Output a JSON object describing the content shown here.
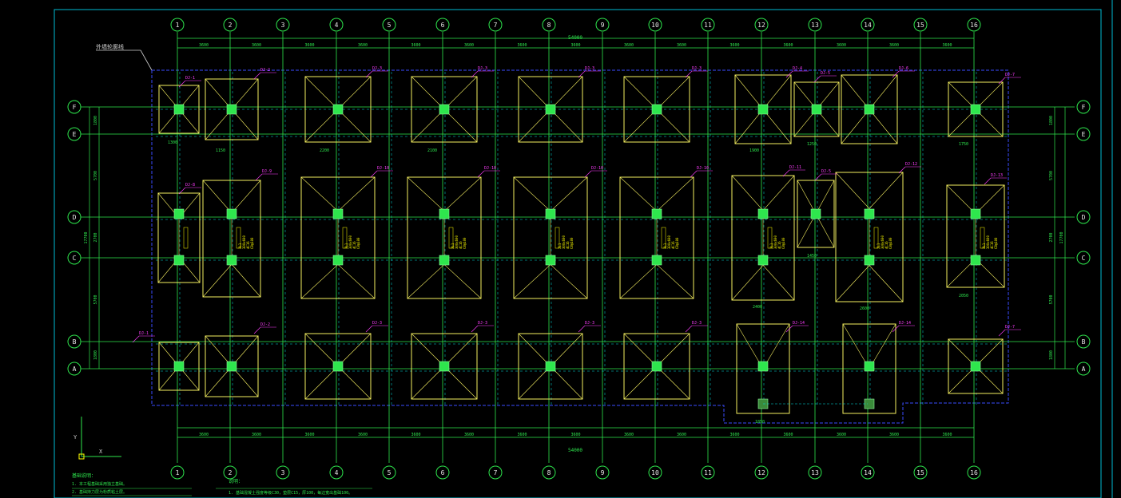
{
  "colors": {
    "background": "#000000",
    "frame": "#00bcd4",
    "grid": "#2ee64d",
    "axisLine": "#00e0e0",
    "footing": "#f5ef61",
    "column": "#2ee64d",
    "tag": "#ff3dff",
    "boundary": "#3a4bff",
    "dim": "#2ee64d",
    "note": "#ffff00"
  },
  "drawing": {
    "callout_label": "外墙轮廓线",
    "total_dim_top": "54000",
    "total_dim_bottom": "54000",
    "axis_numbers": [
      "1",
      "2",
      "3",
      "4",
      "5",
      "6",
      "7",
      "8",
      "9",
      "10",
      "11",
      "12",
      "13",
      "14",
      "15",
      "16"
    ],
    "axis_letters": [
      "F",
      "E",
      "D",
      "C",
      "B",
      "A"
    ],
    "spans_top": [
      "3600",
      "3600",
      "3600",
      "3600",
      "3600",
      "3600",
      "3600",
      "3600",
      "3600",
      "3600",
      "3600",
      "3600",
      "3600",
      "3600",
      "3600"
    ],
    "spans_bottom": [
      "3600",
      "3600",
      "3600",
      "3600",
      "3600",
      "3600",
      "3600",
      "3600",
      "3600",
      "3600",
      "3600",
      "3600",
      "3600",
      "3600",
      "3600"
    ],
    "left_dims": [
      "1800",
      "5700",
      "2700",
      "5700",
      "1800"
    ],
    "right_dims": [
      "1800",
      "5700",
      "2700",
      "5700",
      "1800"
    ],
    "left_total": "17700",
    "right_total": "17700",
    "tags": [
      "DJ-1",
      "DJ-2",
      "DJ-3",
      "DJ-3",
      "DJ-3",
      "DJ-3",
      "DJ-4",
      "DJ-5",
      "DJ-6",
      "DJ-7",
      "DJ-8",
      "DJ-9",
      "DJ-10",
      "DJ-10",
      "DJ-10",
      "DJ-10",
      "DJ-11",
      "DJ-5",
      "DJ-12",
      "DJ-13",
      "DJ-1",
      "DJ-2",
      "DJ-3",
      "DJ-3",
      "DJ-3",
      "DJ-3",
      "DJ-14",
      "DJ-14",
      "DJ-7"
    ],
    "footing_dims": {
      "w1": "1300",
      "w2": "1150",
      "w3": "2200",
      "w4": "2100",
      "w5": "1900",
      "w6": "1250",
      "w7": "1750",
      "w8": "1450",
      "w9": "2400",
      "w10": "2600",
      "w11": "2050",
      "w12": "1850"
    },
    "note_text": [
      "JL1",
      "300x600",
      "4C16",
      "C8@100"
    ],
    "coord_x": "X",
    "coord_y": "Y"
  },
  "notes_left": {
    "title": "基础说明：",
    "lines": [
      "1. 本工程基础采用独立基础。",
      "2. 基础持力层为粉质粘土层。"
    ]
  },
  "notes_right": {
    "title": "说明：",
    "lines": [
      "1. 基础混凝土强度等级C30，垫层C15，厚100，每边宽出基础100。"
    ]
  }
}
